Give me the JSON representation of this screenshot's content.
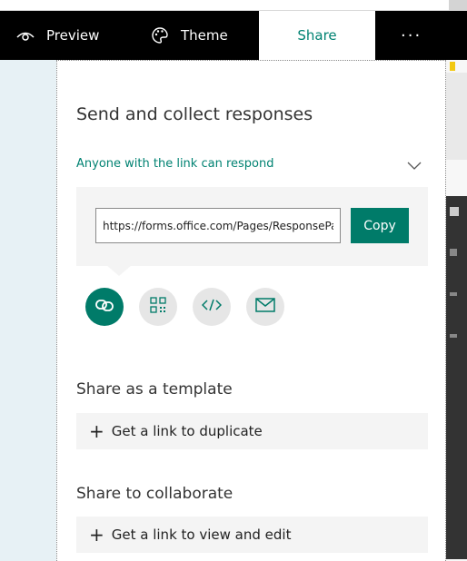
{
  "toolbar": {
    "preview_label": "Preview",
    "theme_label": "Theme",
    "share_label": "Share",
    "more_label": "···"
  },
  "share": {
    "title": "Send and collect responses",
    "audience_selected": "Anyone with the link can respond",
    "link_value": "https://forms.office.com/Pages/ResponsePage.aspx",
    "copy_label": "Copy",
    "icons": [
      "link-icon",
      "qr-code-icon",
      "embed-code-icon",
      "email-icon"
    ]
  },
  "template_section": {
    "title": "Share as a template",
    "action_label": "Get a link to duplicate"
  },
  "collaborate_section": {
    "title": "Share to collaborate",
    "action_label": "Get a link to view and edit"
  },
  "colors": {
    "accent": "#007b69",
    "toolbar_bg": "#000000",
    "left_panel_bg": "#e7f1f5"
  }
}
